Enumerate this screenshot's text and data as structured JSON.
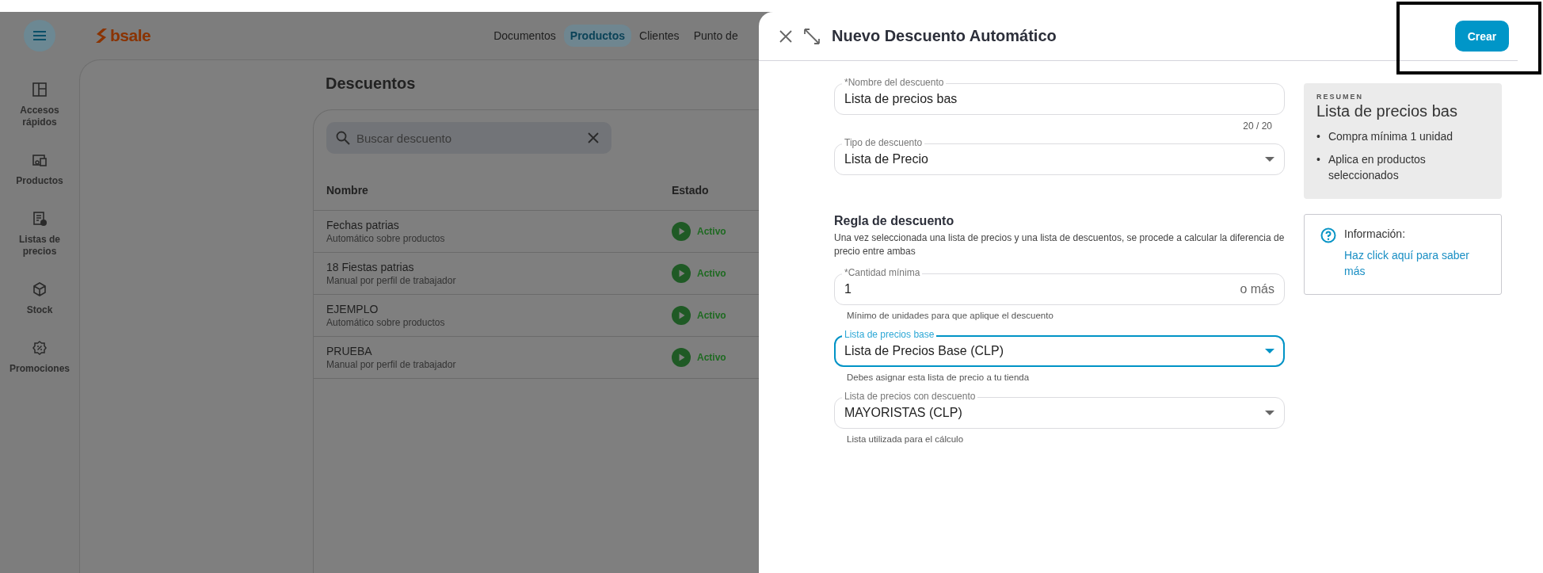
{
  "topbar": {
    "logo_text": "bsale",
    "nav": [
      {
        "label": "Documentos",
        "selected": false
      },
      {
        "label": "Productos",
        "selected": true
      },
      {
        "label": "Clientes",
        "selected": false
      },
      {
        "label": "Punto de",
        "selected": false
      }
    ]
  },
  "sidebar": {
    "items": [
      {
        "label": "Accesos rápidos"
      },
      {
        "label": "Productos"
      },
      {
        "label": "Listas de precios"
      },
      {
        "label": "Stock"
      },
      {
        "label": "Promociones"
      }
    ]
  },
  "page": {
    "title": "Descuentos",
    "search": {
      "placeholder": "Buscar descuento"
    },
    "table": {
      "columns": [
        "Nombre",
        "Estado"
      ],
      "rows": [
        {
          "name": "Fechas patrias",
          "subtitle": "Automático sobre productos",
          "status": "Activo"
        },
        {
          "name": "18 Fiestas patrias",
          "subtitle": "Manual por perfil de trabajador",
          "status": "Activo"
        },
        {
          "name": "EJEMPLO",
          "subtitle": "Automático sobre productos",
          "status": "Activo"
        },
        {
          "name": "PRUEBA",
          "subtitle": "Manual por perfil de trabajador",
          "status": "Activo"
        }
      ]
    }
  },
  "drawer": {
    "title": "Nuevo Descuento Automático",
    "primary_button": "Crear",
    "fields": [
      {
        "kind": "text",
        "label": "*Nombre del descuento",
        "value": "Lista de precios bas",
        "counter": "20 / 20",
        "focused": false
      },
      {
        "kind": "select",
        "label": "Tipo de descuento",
        "value": "Lista de Precio",
        "focused": false
      }
    ],
    "rule": {
      "title": "Regla de descuento",
      "description": "Una vez seleccionada una lista de precios y una lista de descuentos, se procede a calcular la diferencia de precio entre ambas",
      "fields": [
        {
          "kind": "text",
          "label": "*Cantidad mínima",
          "value": "1",
          "suffix": "o más",
          "helper": "Mínimo de unidades para que aplique el descuento",
          "focused": false
        },
        {
          "kind": "select",
          "label": "Lista de precios base",
          "value": "Lista de Precios Base (CLP)",
          "helper": "Debes asignar esta lista de precio a tu tienda",
          "focused": true
        },
        {
          "kind": "select",
          "label": "Lista de precios con descuento",
          "value": "MAYORISTAS (CLP)",
          "helper": "Lista utilizada para el cálculo",
          "focused": false
        }
      ]
    },
    "summary": {
      "eyebrow": "RESUMEN",
      "title": "Lista de precios bas",
      "bullets": [
        {
          "marker": "•",
          "text": "Compra mínima 1 unidad"
        },
        {
          "marker": "•",
          "text": "Aplica en productos seleccionados"
        }
      ]
    },
    "info": {
      "title": "Información:",
      "link": "Haz click aquí para saber más"
    }
  }
}
